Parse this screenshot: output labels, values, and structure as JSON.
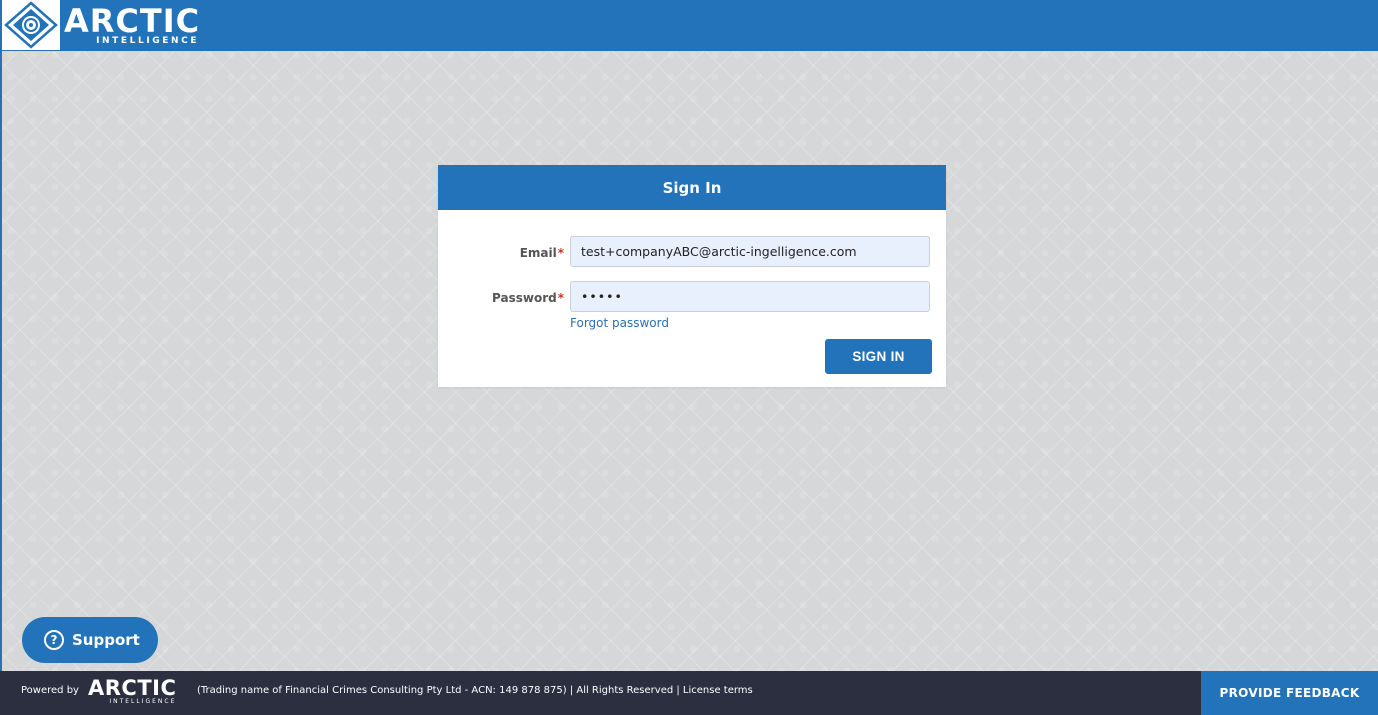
{
  "brand": {
    "name": "ARCTIC",
    "subtitle": "INTELLIGENCE",
    "logo_icon": "compass-diamond-icon"
  },
  "signin": {
    "title": "Sign In",
    "email_label": "Email",
    "email_value": "test+companyABC@arctic-ingelligence.com",
    "password_label": "Password",
    "password_value": "•••••",
    "required_mark": "*",
    "forgot_label": "Forgot password",
    "submit_label": "SIGN IN"
  },
  "support": {
    "label": "Support",
    "icon": "question-circle-icon",
    "icon_glyph": "?"
  },
  "footer": {
    "powered_by": "Powered by",
    "brand_name": "ARCTIC",
    "brand_subtitle": "INTELLIGENCE",
    "legal_text": "(Trading name of Financial Crimes Consulting Pty Ltd - ACN: 149 878 875) | All Rights Reserved | License terms",
    "feedback_label": "PROVIDE FEEDBACK"
  },
  "colors": {
    "primary": "#2273b9",
    "footer_bg": "#2b2f3f",
    "page_bg": "#d6d7d9",
    "input_bg": "#e8f0fe",
    "required": "#c0392b",
    "link": "#2a6fb4"
  }
}
